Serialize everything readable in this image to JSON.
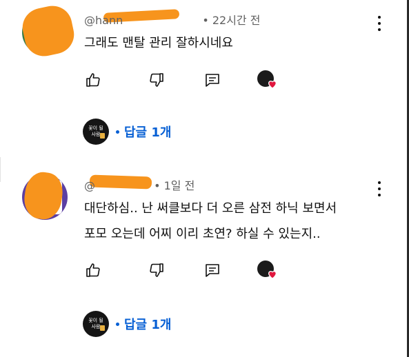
{
  "colors": {
    "accent_blue": "#065fd4",
    "text": "#0f0f0f",
    "meta": "#606060",
    "highlight_scribble": "#f7941d",
    "heart_red": "#e1173f"
  },
  "comments": [
    {
      "handle": "@hann",
      "time": "22시간 전",
      "text_lines": [
        "그래도 맨탈 관리 잘하시네요"
      ],
      "reply_label": "답글 1개",
      "avatar_color": "#2f7a4a",
      "creator_avatar_text": [
        "꽃이 될",
        "사람"
      ]
    },
    {
      "handle": "@",
      "time": "1일 전",
      "text_lines": [
        "대단하심.. 난 써클보다 더 오른 삼전 하닉 보면서",
        "포모 오는데 어찌 이리 초연? 하실 수 있는지.."
      ],
      "reply_label": "답글 1개",
      "avatar_color": "#5b3fa3",
      "creator_avatar_text": [
        "꽃이 될",
        "사람"
      ]
    }
  ],
  "icons": {
    "like": "thumbs-up-icon",
    "dislike": "thumbs-down-icon",
    "reply": "comment-icon",
    "creator_heart": "creator-heart-icon",
    "more": "more-vert-icon"
  }
}
